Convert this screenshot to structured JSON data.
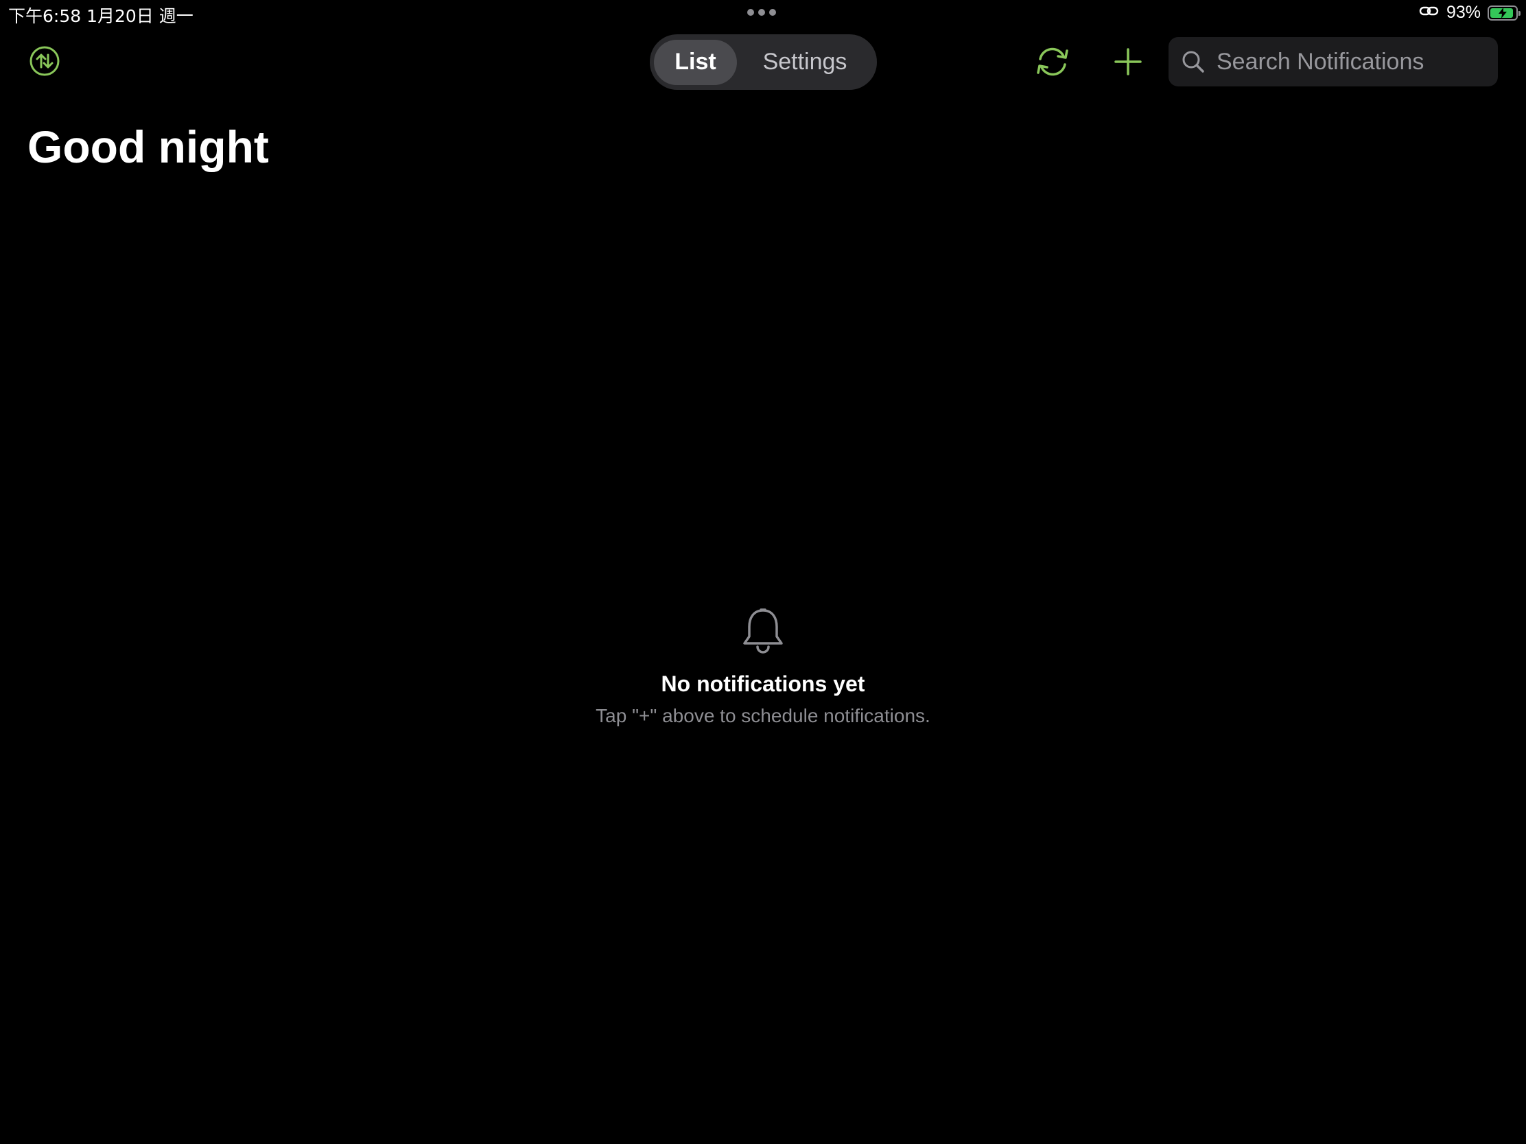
{
  "status_bar": {
    "time_date": "下午6:58   1月20日 週一",
    "battery_percent": "93%",
    "battery_level": 0.93,
    "icons": [
      "link-icon",
      "battery-charging-icon"
    ]
  },
  "toolbar": {
    "segments": [
      {
        "label": "List",
        "selected": true
      },
      {
        "label": "Settings",
        "selected": false
      }
    ],
    "search": {
      "placeholder": "Search Notifications",
      "value": ""
    },
    "icons": [
      "sort-arrows-icon",
      "refresh-icon",
      "plus-icon",
      "search-icon"
    ]
  },
  "header": {
    "title": "Good night"
  },
  "empty_state": {
    "icon": "bell-icon",
    "title": "No notifications yet",
    "subtitle": "Tap \"+\" above to schedule notifications."
  },
  "colors": {
    "background": "#000000",
    "accent": "#8ac75a",
    "secondary_text": "#8e8e93",
    "segment_bg": "#2a2a2d",
    "segment_active": "#4a4a4e",
    "search_bg": "#1c1c1e",
    "battery": "#34c759"
  }
}
